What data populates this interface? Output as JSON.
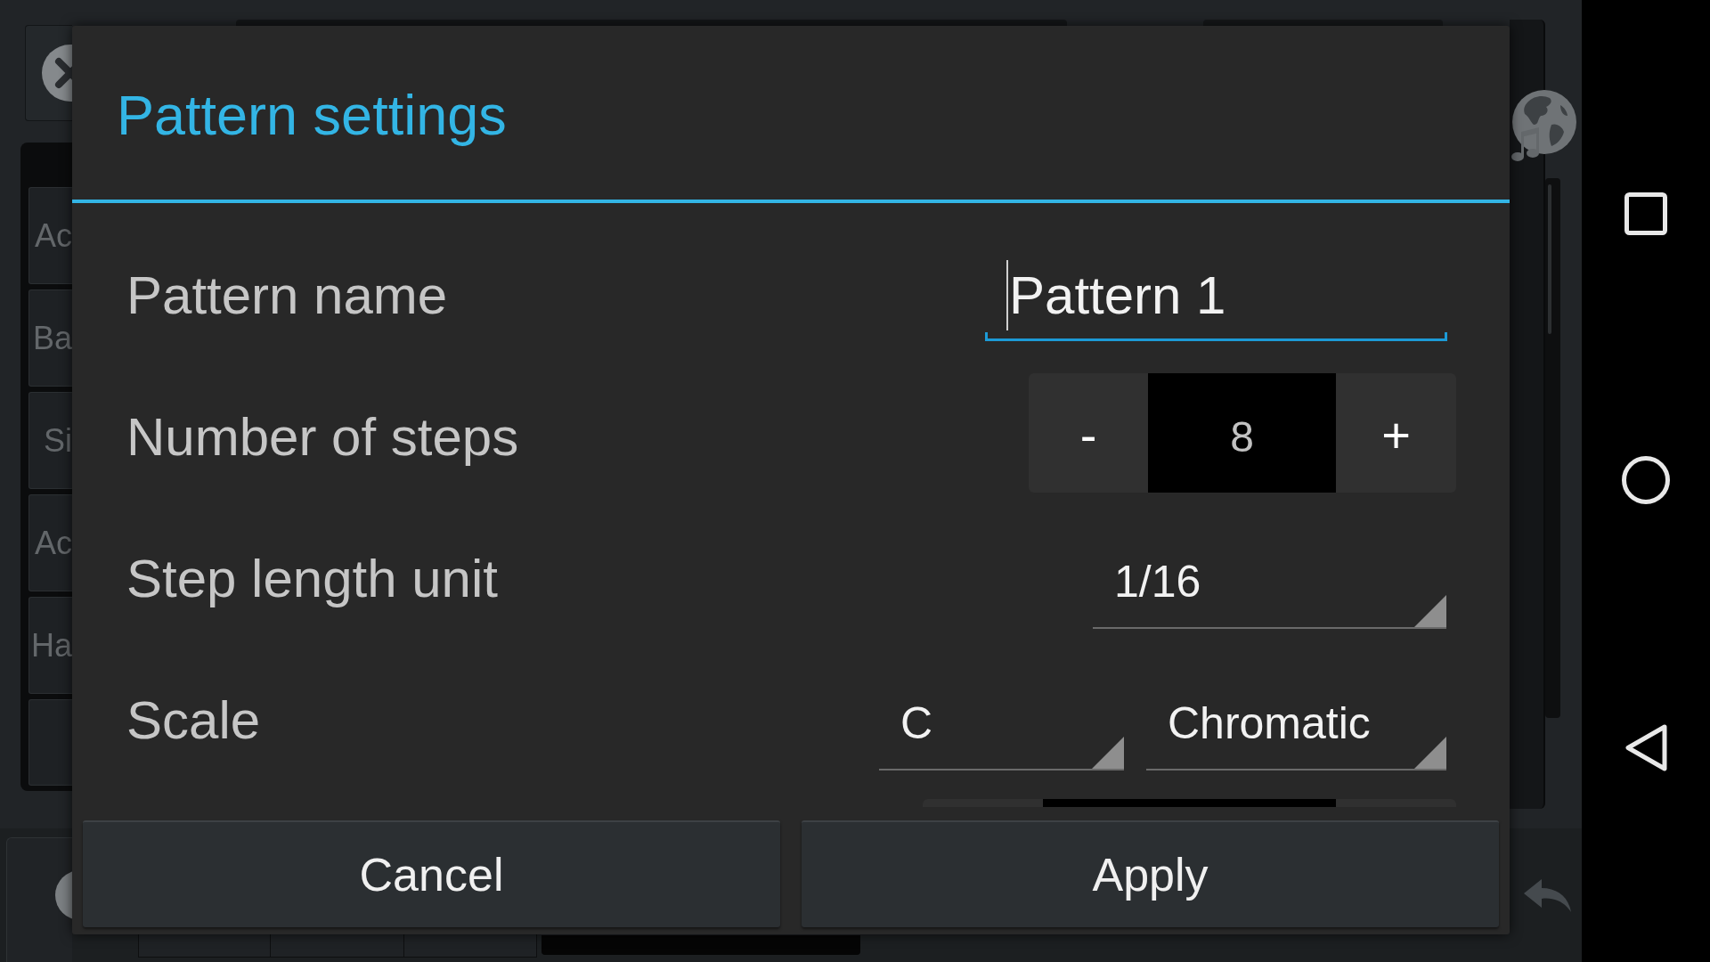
{
  "background": {
    "list_items": [
      "Ac",
      "Ba",
      "Si",
      "Ac",
      "Ha"
    ]
  },
  "dialog": {
    "title": "Pattern settings",
    "rows": [
      {
        "kind": "text_field",
        "label": "Pattern name",
        "value": "Pattern 1",
        "focused": true
      },
      {
        "kind": "stepper",
        "label": "Number of steps",
        "decrement": "-",
        "value": "8",
        "increment": "+"
      },
      {
        "kind": "dropdown",
        "label": "Step length unit",
        "values": [
          "1/16"
        ]
      },
      {
        "kind": "dropdown",
        "label": "Scale",
        "values": [
          "C",
          "Chromatic"
        ]
      }
    ],
    "buttons": [
      "Cancel",
      "Apply"
    ]
  }
}
